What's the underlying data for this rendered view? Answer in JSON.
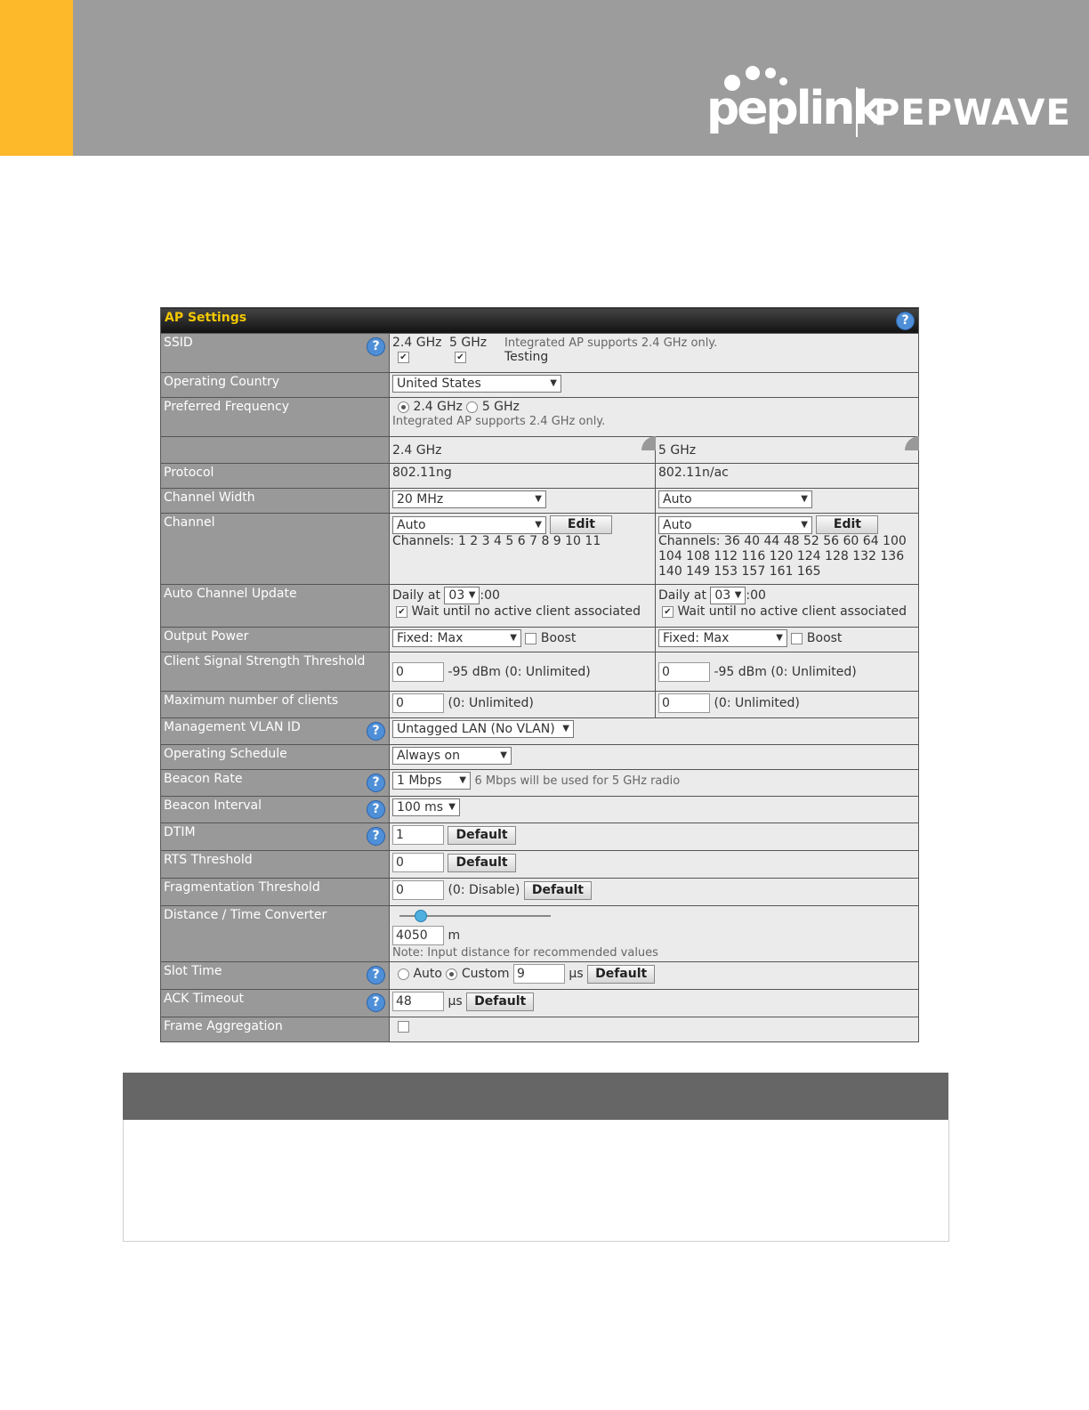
{
  "header": {
    "brand_primary": "peplink",
    "brand_secondary": "PEPWAVE",
    "colors": {
      "accent": "#fdb92a",
      "band": "#9c9c9c"
    }
  },
  "ap_settings": {
    "title": "AP Settings",
    "ssid": {
      "label": "SSID",
      "col_24": "2.4 GHz",
      "col_5": "5 GHz",
      "note": "Integrated AP supports 2.4 GHz only.",
      "ssid_name": "Testing"
    },
    "operating_country": {
      "label": "Operating Country",
      "value": "United States"
    },
    "preferred_frequency": {
      "label": "Preferred Frequency",
      "opt_24": "2.4 GHz",
      "opt_5": "5 GHz",
      "note": "Integrated AP supports 2.4 GHz only."
    },
    "band_headers": {
      "b24": "2.4 GHz",
      "b5": "5 GHz"
    },
    "protocol": {
      "label": "Protocol",
      "b24": "802.11ng",
      "b5": "802.11n/ac"
    },
    "channel_width": {
      "label": "Channel Width",
      "b24": "20 MHz",
      "b5": "Auto"
    },
    "channel": {
      "label": "Channel",
      "b24": "Auto",
      "b5": "Auto",
      "edit": "Edit",
      "b24_channels": "Channels: 1 2 3 4 5 6 7 8 9 10 11",
      "b5_channels": "Channels: 36 40 44 48 52 56 60 64 100 104 108 112 116 120 124 128 132 136 140 149 153 157 161 165"
    },
    "auto_channel_update": {
      "label": "Auto Channel Update",
      "daily_at": "Daily at",
      "hour": "03",
      "minutes": ":00",
      "wait": "Wait until no active client associated"
    },
    "output_power": {
      "label": "Output Power",
      "value": "Fixed: Max",
      "boost": "Boost"
    },
    "client_signal": {
      "label": "Client Signal Strength Threshold",
      "value": "0",
      "hint": "-95 dBm (0: Unlimited)"
    },
    "max_clients": {
      "label": "Maximum number of clients",
      "value": "0",
      "hint": "(0: Unlimited)"
    },
    "mgmt_vlan": {
      "label": "Management VLAN ID",
      "value": "Untagged LAN (No VLAN)"
    },
    "operating_schedule": {
      "label": "Operating Schedule",
      "value": "Always on"
    },
    "beacon_rate": {
      "label": "Beacon Rate",
      "value": "1 Mbps",
      "note": "6 Mbps will be used for 5 GHz radio"
    },
    "beacon_interval": {
      "label": "Beacon Interval",
      "value": "100 ms"
    },
    "dtim": {
      "label": "DTIM",
      "value": "1",
      "default": "Default"
    },
    "rts": {
      "label": "RTS Threshold",
      "value": "0",
      "default": "Default"
    },
    "fragmentation": {
      "label": "Fragmentation Threshold",
      "value": "0",
      "hint": "(0: Disable)",
      "default": "Default"
    },
    "distance": {
      "label": "Distance / Time Converter",
      "value": "4050",
      "unit": "m",
      "note": "Note: Input distance for recommended values"
    },
    "slot_time": {
      "label": "Slot Time",
      "auto": "Auto",
      "custom": "Custom",
      "value": "9",
      "unit": "μs",
      "default": "Default"
    },
    "ack_timeout": {
      "label": "ACK Timeout",
      "value": "48",
      "unit": "μs",
      "default": "Default"
    },
    "frame_aggregation": {
      "label": "Frame Aggregation"
    }
  }
}
